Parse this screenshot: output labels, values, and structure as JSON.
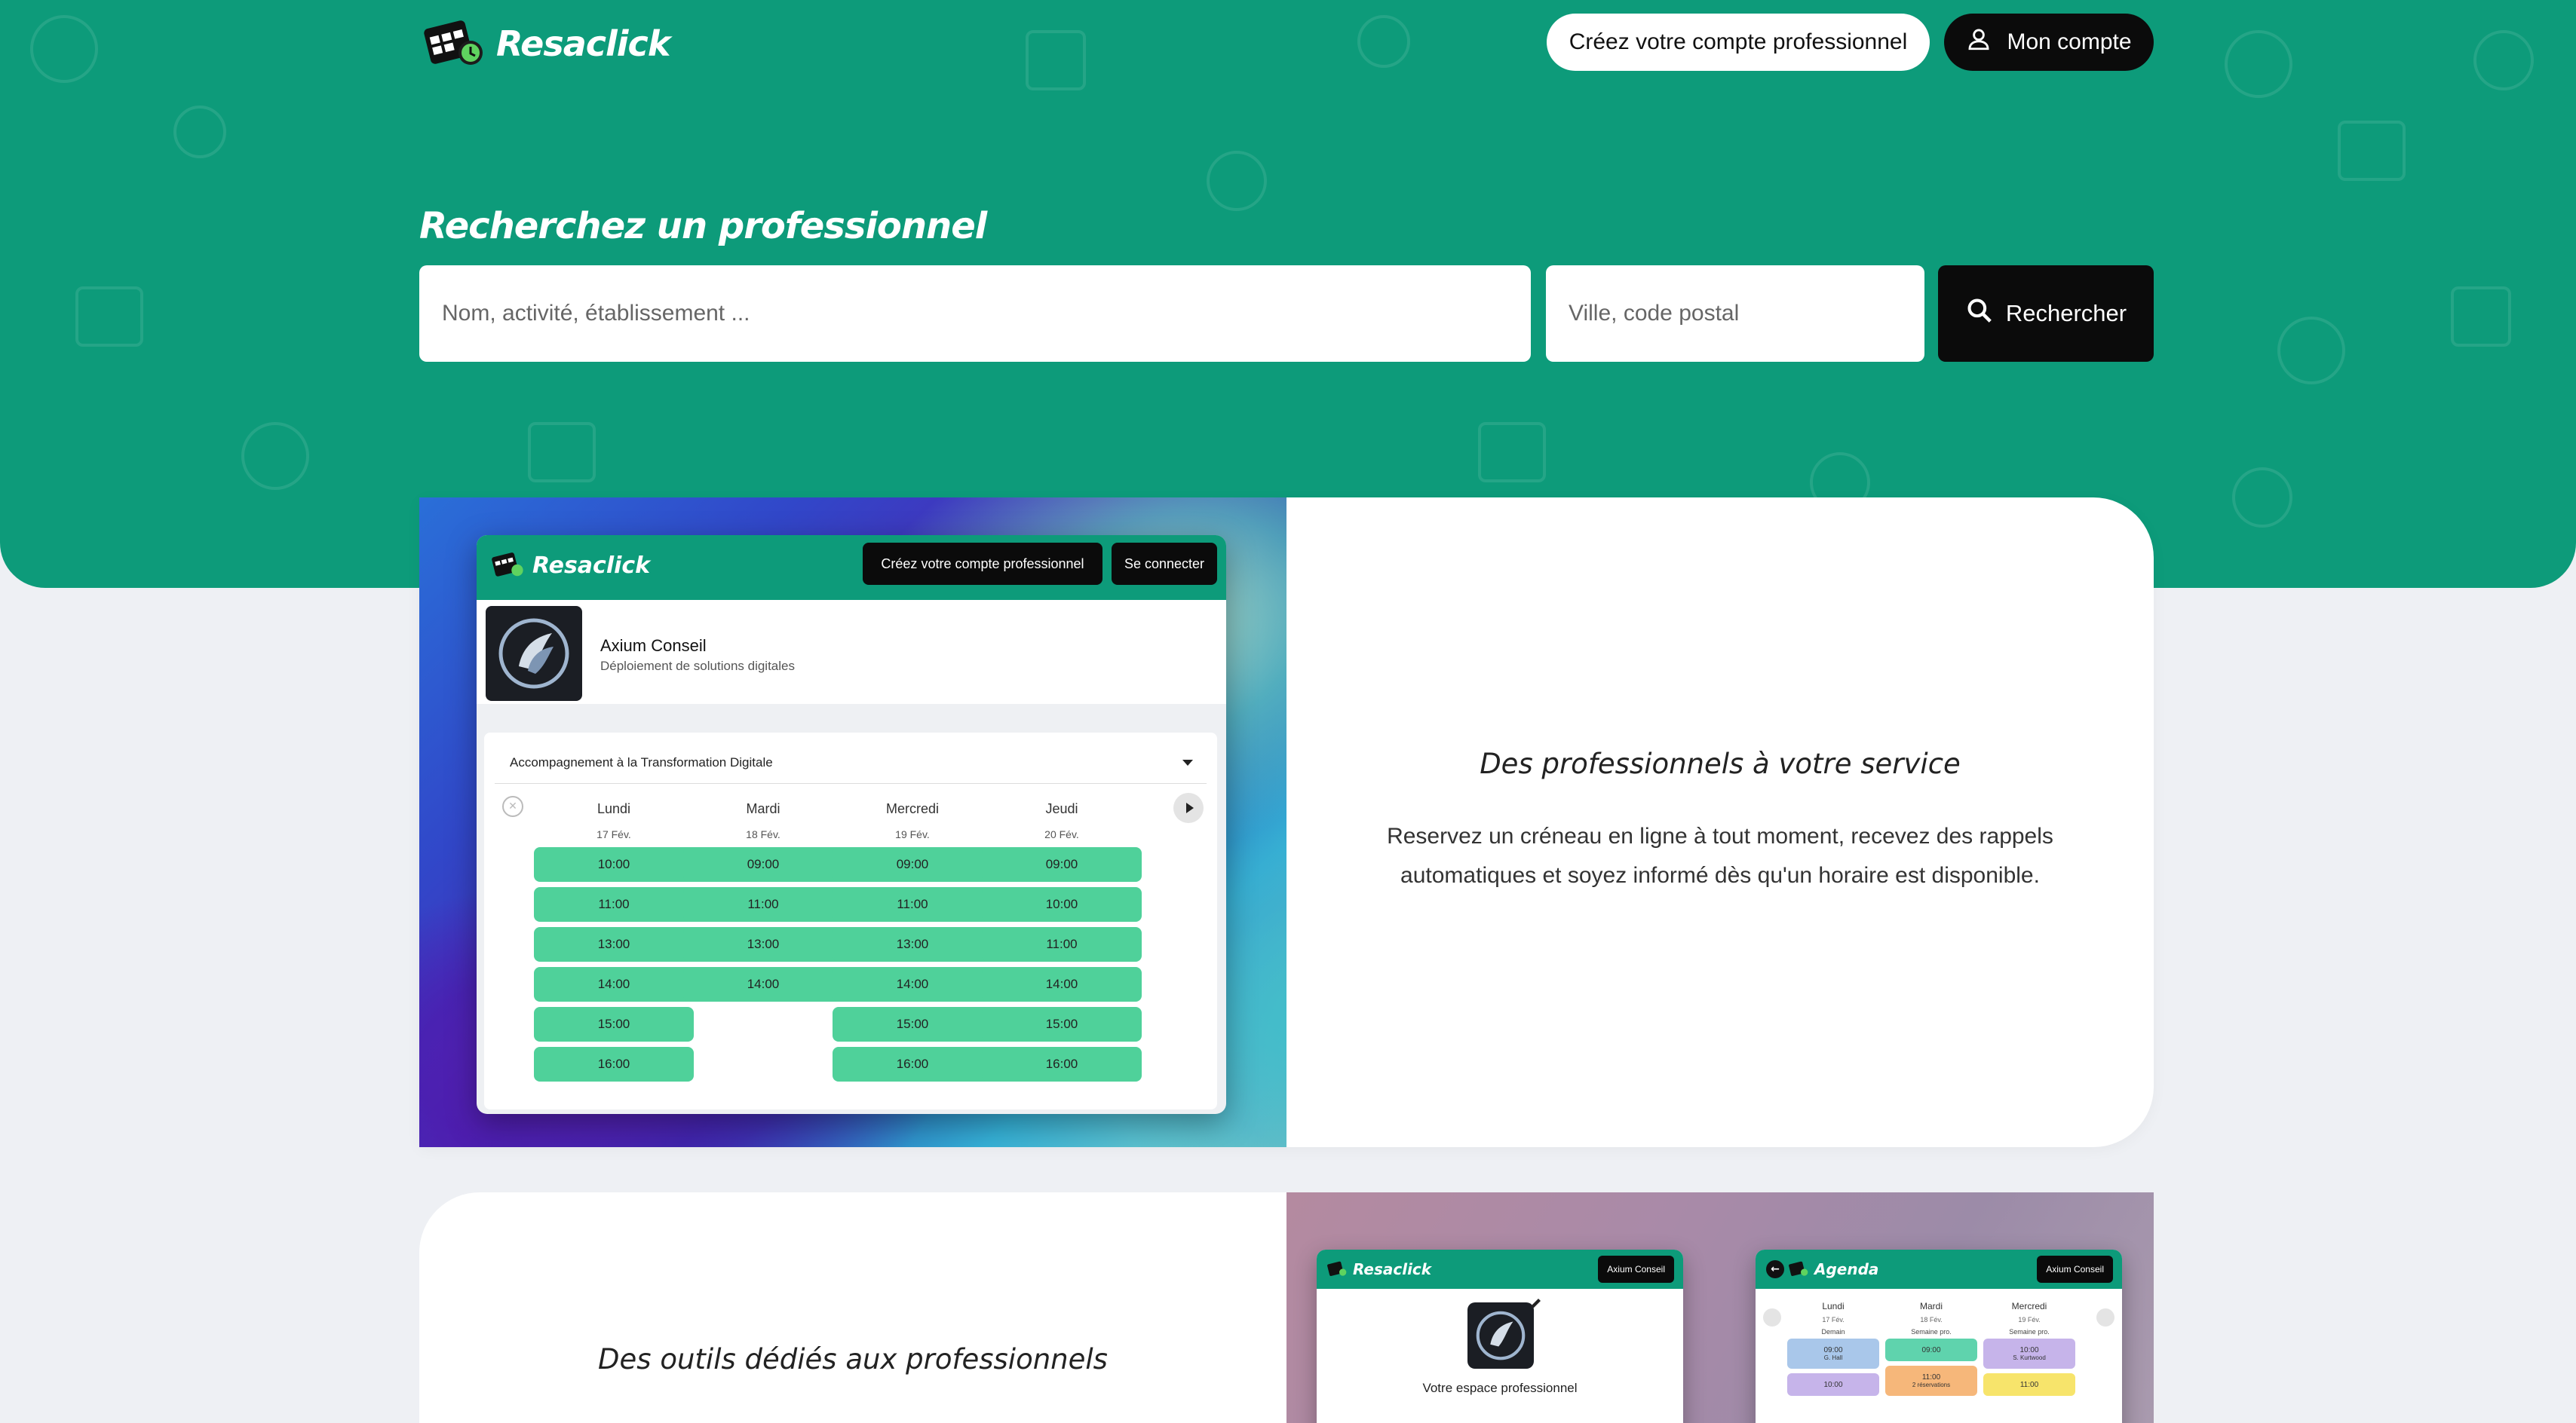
{
  "brand": {
    "name": "Resaclick",
    "color": "#0d9b7a"
  },
  "header": {
    "pro_button": "Créez votre compte professionnel",
    "account_button": "Mon compte",
    "account_icon": "user-icon"
  },
  "search": {
    "title": "Recherchez un professionnel",
    "name_placeholder": "Nom, activité, établissement ...",
    "city_placeholder": "Ville, code postal",
    "button": "Rechercher",
    "button_icon": "search-icon"
  },
  "feature1": {
    "heading": "Des professionnels à votre service",
    "text_line1": "Reservez un créneau en ligne à tout moment, recevez des rappels",
    "text_line2": "automatiques et soyez informé dès qu'un horaire est disponible.",
    "mock": {
      "brand": "Resaclick",
      "btn_pro": "Créez votre compte professionnel",
      "btn_login": "Se connecter",
      "business_name": "Axium Conseil",
      "business_sub": "Déploiement de solutions digitales",
      "service": "Accompagnement à la Transformation Digitale",
      "days": [
        {
          "day": "Lundi",
          "date": "17 Fév.",
          "slots": [
            "10:00",
            "11:00",
            "13:00",
            "14:00",
            "15:00",
            "16:00"
          ]
        },
        {
          "day": "Mardi",
          "date": "18 Fév.",
          "slots": [
            "09:00",
            "11:00",
            "13:00",
            "14:00"
          ]
        },
        {
          "day": "Mercredi",
          "date": "19 Fév.",
          "slots": [
            "09:00",
            "11:00",
            "13:00",
            "14:00",
            "15:00",
            "16:00"
          ]
        },
        {
          "day": "Jeudi",
          "date": "20 Fév.",
          "slots": [
            "09:00",
            "10:00",
            "11:00",
            "14:00",
            "15:00",
            "16:00"
          ]
        }
      ]
    }
  },
  "feature2": {
    "heading": "Des outils dédiés aux professionnels",
    "mock_left": {
      "brand": "Resaclick",
      "btn": "Axium Conseil",
      "label": "Votre espace professionnel"
    },
    "mock_right": {
      "title": "Agenda",
      "btn": "Axium Conseil",
      "days": [
        {
          "day": "Lundi",
          "date": "17 Fév.",
          "note": "Demain"
        },
        {
          "day": "Mardi",
          "date": "18 Fév.",
          "note": "Semaine pro."
        },
        {
          "day": "Mercredi",
          "date": "19 Fév.",
          "note": "Semaine pro."
        }
      ],
      "slots": [
        {
          "col": 0,
          "time": "09:00",
          "sub": "G. Hall",
          "color": "#a9c7ea"
        },
        {
          "col": 0,
          "time": "10:00",
          "sub": "",
          "color": "#c6b4ea"
        },
        {
          "col": 1,
          "time": "09:00",
          "sub": "",
          "color": "#5fd3ad"
        },
        {
          "col": 1,
          "time": "11:00",
          "sub": "2 réservations",
          "color": "#f6b77a"
        },
        {
          "col": 2,
          "time": "10:00",
          "sub": "S. Kurtwood",
          "color": "#c6b4ea"
        },
        {
          "col": 2,
          "time": "11:00",
          "sub": "",
          "color": "#f7e46b"
        }
      ]
    }
  }
}
